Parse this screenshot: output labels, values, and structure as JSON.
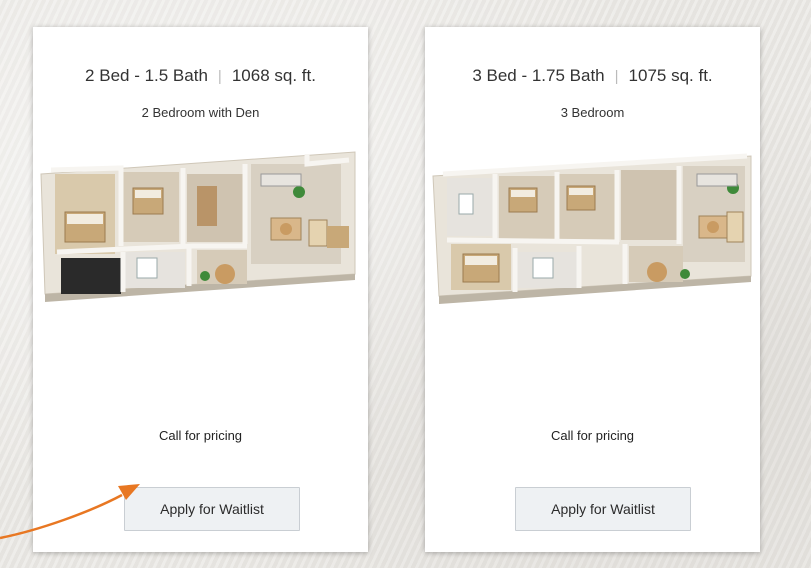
{
  "listings": [
    {
      "beds_baths": "2 Bed - 1.5 Bath",
      "separator": "|",
      "sqft": "1068 sq. ft.",
      "name": "2 Bedroom with Den",
      "price": "Call for pricing",
      "button_label": "Apply for Waitlist"
    },
    {
      "beds_baths": "3 Bed - 1.75 Bath",
      "separator": "|",
      "sqft": "1075 sq. ft.",
      "name": "3 Bedroom",
      "price": "Call for pricing",
      "button_label": "Apply for Waitlist"
    }
  ],
  "colors": {
    "annotation_arrow": "#e87722",
    "button_bg": "#eef1f3",
    "floor": "#d8cfc0",
    "wall": "#f4f2ee"
  }
}
